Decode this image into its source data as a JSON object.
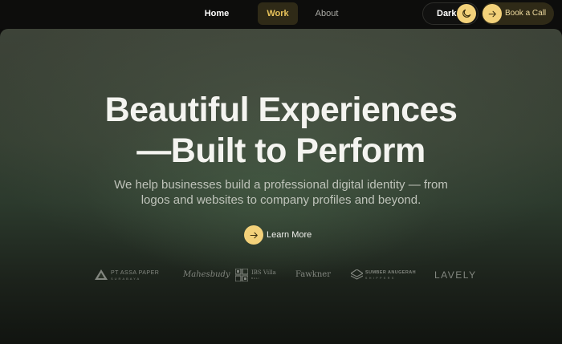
{
  "nav": {
    "links": [
      {
        "label": "Home",
        "state": "default"
      },
      {
        "label": "Work",
        "state": "active"
      },
      {
        "label": "About",
        "state": "default"
      }
    ],
    "theme_toggle": {
      "label": "Dark",
      "icon": "moon-icon"
    },
    "cta": {
      "label": "Book a Call",
      "icon": "arrow-right-icon"
    }
  },
  "hero": {
    "title_line1": "Beautiful Experiences",
    "title_line2": "—Built to Perform",
    "subtitle_line1": "We help businesses build a professional digital identity — from",
    "subtitle_line2": "logos and websites to company profiles and beyond.",
    "cta": {
      "label": "Learn More",
      "icon": "arrow-right-icon"
    }
  },
  "clients": {
    "logos": [
      {
        "name": "PT ASSA PAPER",
        "sub": "SURABAYA"
      },
      {
        "name": "Mahesbudy"
      },
      {
        "name": "IBS Villa",
        "sub": "BALI"
      },
      {
        "name": "Fawkner"
      },
      {
        "name": "SUMBER ANUGERAH",
        "sub": "SHIPPERS"
      },
      {
        "name": "LAVELY"
      }
    ]
  },
  "colors": {
    "accent": "#f3d17a",
    "accent_dark": "#2f2a17",
    "active_text": "#e8c25a",
    "nav_bg": "#0d0d0c"
  }
}
